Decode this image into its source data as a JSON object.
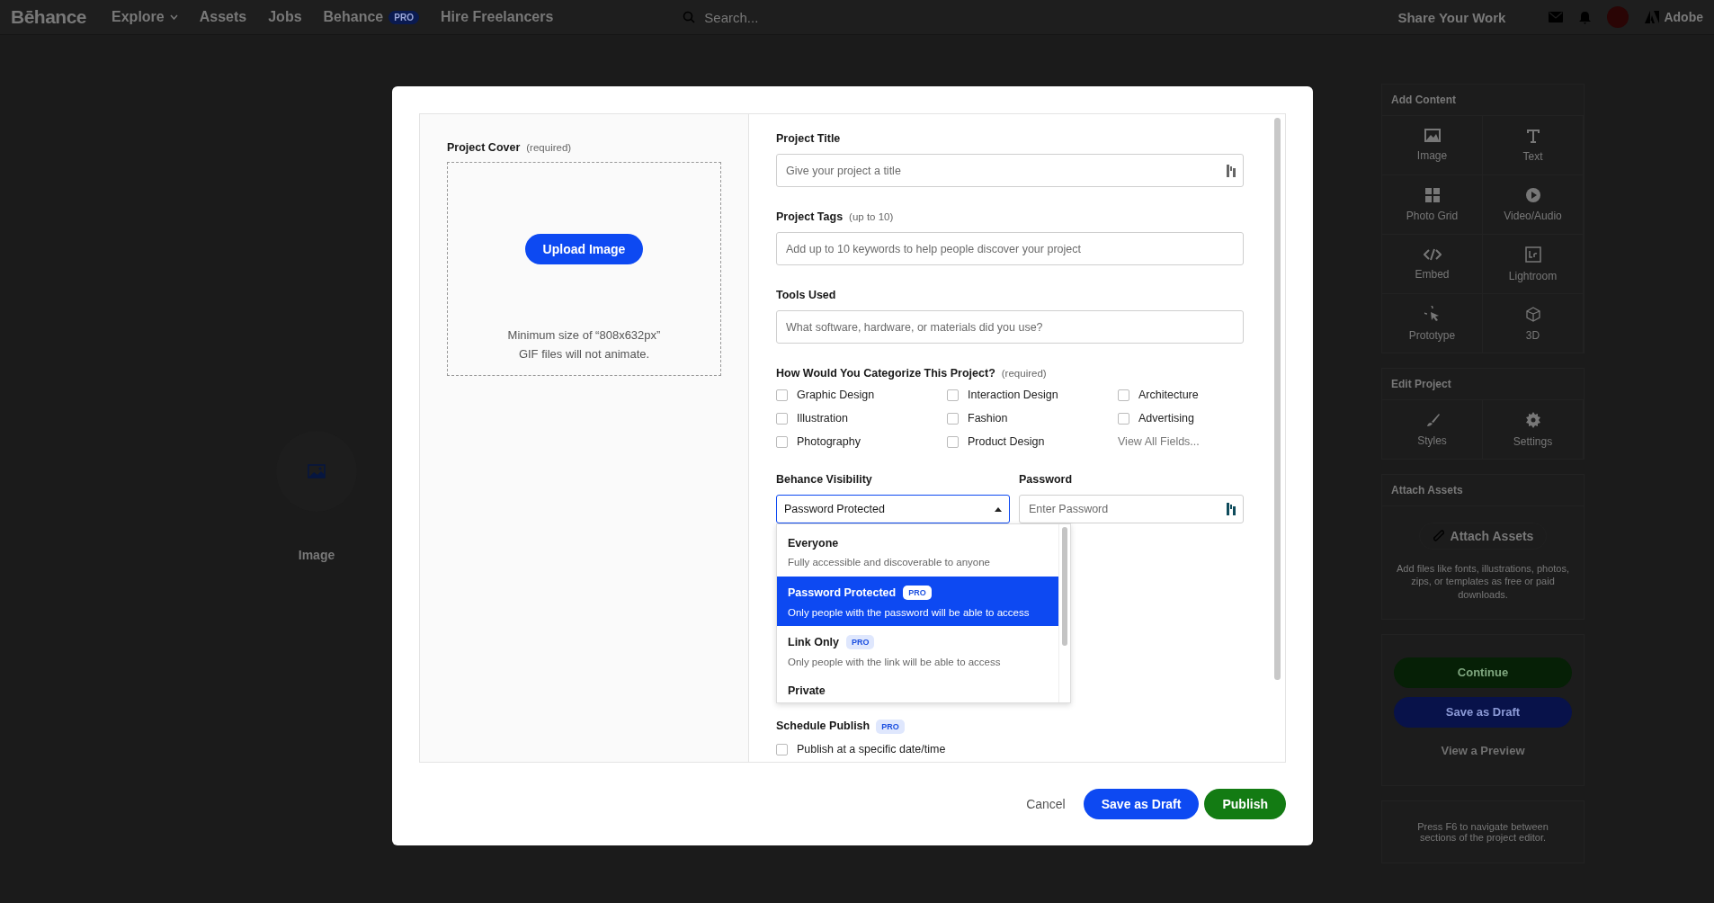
{
  "nav": {
    "logo": "Bēhance",
    "items": [
      {
        "label": "Explore",
        "caret": true
      },
      {
        "label": "Assets"
      },
      {
        "label": "Jobs"
      },
      {
        "label": "Behance",
        "badge": "PRO"
      },
      {
        "label": "Hire Freelancers"
      }
    ],
    "search": {
      "placeholder": "Search..."
    },
    "share": "Share Your Work",
    "brand": "Adobe"
  },
  "canvas": {
    "block_label": "Image"
  },
  "side_panel": {
    "sections": [
      {
        "title": "Add Content",
        "tiles": [
          {
            "label": "Image"
          },
          {
            "label": "Text"
          },
          {
            "label": "Photo Grid"
          },
          {
            "label": "Video/Audio"
          },
          {
            "label": "Embed"
          },
          {
            "label": "Lightroom"
          },
          {
            "label": "Prototype"
          },
          {
            "label": "3D"
          }
        ]
      },
      {
        "title": "Edit Project",
        "tiles": [
          {
            "label": "Styles"
          },
          {
            "label": "Settings"
          }
        ]
      }
    ],
    "assets": {
      "title": "Attach Assets",
      "button": "Attach Assets",
      "text": "Add files like fonts, illustrations, photos, zips, or templates as free or paid downloads."
    },
    "actions": [
      {
        "label": "Continue",
        "kind": "success"
      },
      {
        "label": "Save as Draft",
        "kind": "primary"
      },
      {
        "label": "View a Preview",
        "kind": "link"
      }
    ],
    "hint": "Press F6 to navigate between sections of the project editor."
  },
  "modal": {
    "cover": {
      "label": "Project Cover",
      "note": "(required)",
      "button": "Upload Image",
      "hints": [
        "Minimum size of “808x632px”",
        "GIF files will not animate."
      ]
    },
    "fields": [
      {
        "label": "Project Title",
        "placeholder": "Give your project a title",
        "kind": "keyicon"
      },
      {
        "label": "Project Tags",
        "note": "(up to 10)",
        "placeholder": "Add up to 10 keywords to help people discover your project",
        "kind": "plain"
      },
      {
        "label": "Tools Used",
        "placeholder": "What software, hardware, or materials did you use?",
        "kind": "plain"
      }
    ],
    "categories": {
      "label": "How Would You Categorize This Project?",
      "note": "(required)",
      "options": [
        {
          "label": "Graphic Design",
          "checked": false
        },
        {
          "label": "Interaction Design",
          "checked": false
        },
        {
          "label": "Architecture",
          "checked": false
        },
        {
          "label": "Illustration",
          "checked": false
        },
        {
          "label": "Fashion",
          "checked": false
        },
        {
          "label": "Advertising",
          "checked": false
        },
        {
          "label": "Photography",
          "checked": false
        },
        {
          "label": "Product Design",
          "checked": false
        }
      ],
      "link": "View All Fields..."
    },
    "visibility": {
      "label": "Behance Visibility",
      "value": "Password Protected",
      "expanded": true,
      "options": [
        {
          "title": "Everyone",
          "description": "Fully accessible and discoverable to anyone",
          "selected": false
        },
        {
          "title": "Password Protected",
          "badge": "PRO",
          "description": "Only people with the password will be able to access",
          "selected": true
        },
        {
          "title": "Link Only",
          "badge": "PRO",
          "description": "Only people with the link will be able to access",
          "selected": false
        },
        {
          "title": "Private",
          "selected": false
        }
      ]
    },
    "password": {
      "label": "Password",
      "placeholder": "Enter Password"
    },
    "schedule": {
      "label": "Schedule Publish",
      "badge": "PRO",
      "option": {
        "label": "Publish at a specific date/time",
        "checked": false
      }
    },
    "buttons": [
      {
        "label": "Cancel",
        "kind": "text"
      },
      {
        "label": "Save as Draft",
        "kind": "primary"
      },
      {
        "label": "Publish",
        "kind": "success"
      }
    ]
  }
}
